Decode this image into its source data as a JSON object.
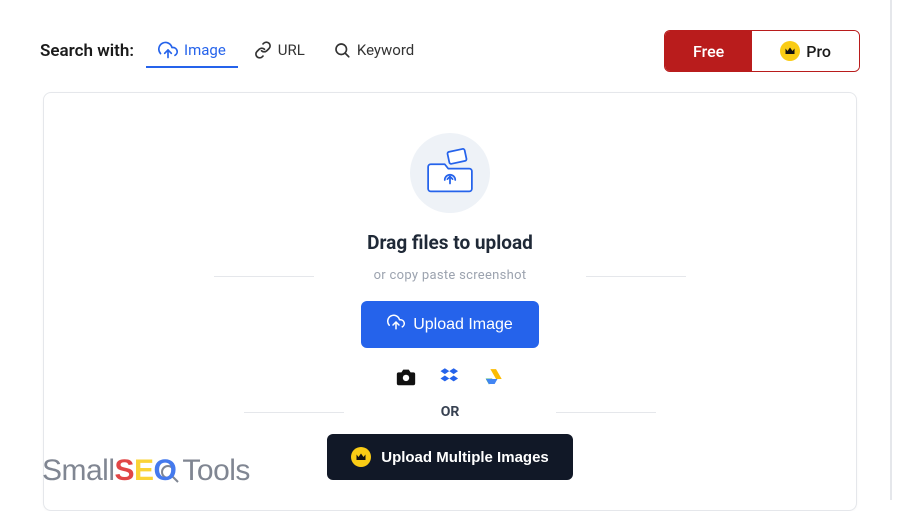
{
  "searchLabel": "Search with:",
  "tabs": {
    "image": "Image",
    "url": "URL",
    "keyword": "Keyword"
  },
  "plans": {
    "free": "Free",
    "pro": "Pro"
  },
  "upload": {
    "dragTitle": "Drag files to upload",
    "orPaste": "or copy paste screenshot",
    "uploadImageBtn": "Upload Image",
    "orDivider": "OR",
    "multiBtn": "Upload Multiple Images"
  },
  "watermark": {
    "small": "Small",
    "s": "S",
    "e": "E",
    "o": "O",
    "tools": "Tools"
  }
}
